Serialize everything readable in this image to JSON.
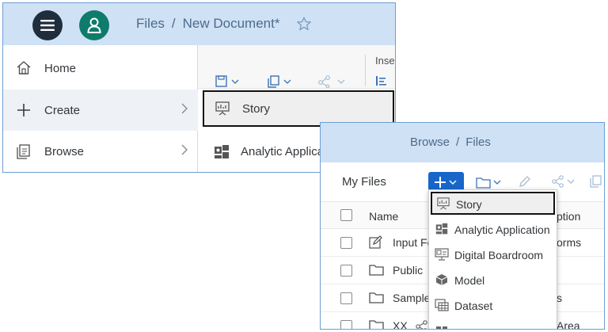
{
  "panel1": {
    "breadcrumb": {
      "root": "Files",
      "separator": "/",
      "current": "New Document*"
    },
    "side_menu": [
      {
        "label": "Home",
        "icon": "home-icon"
      },
      {
        "label": "Create",
        "icon": "plus-icon"
      },
      {
        "label": "Browse",
        "icon": "browse-icon"
      }
    ],
    "toolbar": {
      "insert_label": "Inse"
    },
    "create_submenu": [
      {
        "label": "Story",
        "icon": "story-icon"
      },
      {
        "label": "Analytic Application",
        "icon": "analytic-application-icon"
      }
    ]
  },
  "panel2": {
    "breadcrumb": {
      "root": "Browse",
      "separator": "/",
      "current": "Files"
    },
    "title": "My Files",
    "table": {
      "header_name": "Name",
      "header_desc": "ption",
      "rows": [
        {
          "name": "Input Fo",
          "desc": "orms",
          "icon": "pencil-icon"
        },
        {
          "name": "Public",
          "desc": "",
          "icon": "folder-icon"
        },
        {
          "name": "Sample",
          "desc": "s",
          "icon": "folder-icon"
        },
        {
          "name": "XX",
          "desc": "Area",
          "icon": "folder-icon"
        }
      ]
    },
    "add_menu": [
      {
        "label": "Story",
        "icon": "story-icon"
      },
      {
        "label": "Analytic Application",
        "icon": "analytic-application-icon"
      },
      {
        "label": "Digital Boardroom",
        "icon": "digital-boardroom-icon"
      },
      {
        "label": "Model",
        "icon": "model-icon"
      },
      {
        "label": "Dataset",
        "icon": "dataset-icon"
      }
    ]
  },
  "colors": {
    "shell": "#cfe1f5",
    "border": "#6d9fd4",
    "primary_button": "#1866c9",
    "avatar": "#0f7b6c",
    "menu_button": "#1f2d3d"
  }
}
